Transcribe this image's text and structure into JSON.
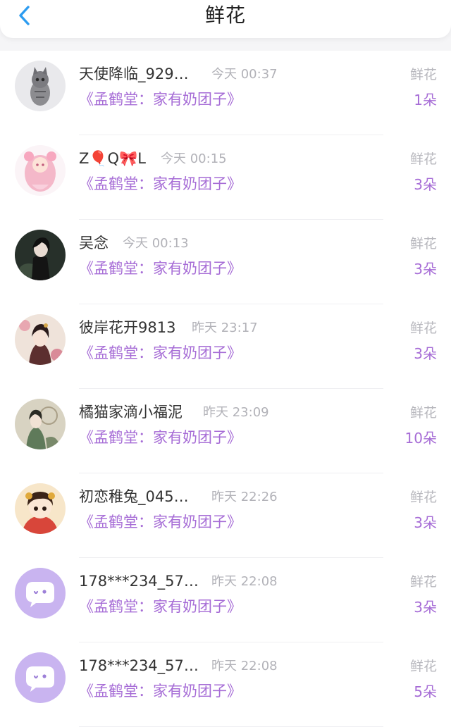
{
  "header": {
    "title": "鲜花",
    "back_icon": "chevron-left-icon",
    "accent_color": "#2d9cf0"
  },
  "colors": {
    "book": "#a66cd6",
    "count": "#a66cd6",
    "muted": "#b2b2b8"
  },
  "items": [
    {
      "name": "天使降临_929…",
      "time": "今天 00:37",
      "book": "《孟鹤堂：家有奶团子》",
      "gift": "鲜花",
      "count": "1朵",
      "avatar": "cat-photo-avatar"
    },
    {
      "name": "Z🎈Q🎀L",
      "time": "今天 00:15",
      "book": "《孟鹤堂：家有奶团子》",
      "gift": "鲜花",
      "count": "3朵",
      "avatar": "pink-anime-girl-avatar"
    },
    {
      "name": "吴念",
      "time": "今天 00:13",
      "book": "《孟鹤堂：家有奶团子》",
      "gift": "鲜花",
      "count": "3朵",
      "avatar": "dark-anime-avatar"
    },
    {
      "name": "彼岸花开9813",
      "time": "昨天 23:17",
      "book": "《孟鹤堂：家有奶团子》",
      "gift": "鲜花",
      "count": "3朵",
      "avatar": "ancient-lady-avatar"
    },
    {
      "name": "橘猫家滴小福泥",
      "time": "昨天 23:09",
      "book": "《孟鹤堂：家有奶团子》",
      "gift": "鲜花",
      "count": "10朵",
      "avatar": "green-costume-avatar"
    },
    {
      "name": "初恋稚兔_045…",
      "time": "昨天 22:26",
      "book": "《孟鹤堂：家有奶团子》",
      "gift": "鲜花",
      "count": "3朵",
      "avatar": "chibi-girl-avatar"
    },
    {
      "name": "178***234_57…",
      "time": "昨天 22:08",
      "book": "《孟鹤堂：家有奶团子》",
      "gift": "鲜花",
      "count": "3朵",
      "avatar": "default-chat-avatar"
    },
    {
      "name": "178***234_57…",
      "time": "昨天 22:08",
      "book": "《孟鹤堂：家有奶团子》",
      "gift": "鲜花",
      "count": "5朵",
      "avatar": "default-chat-avatar"
    }
  ]
}
